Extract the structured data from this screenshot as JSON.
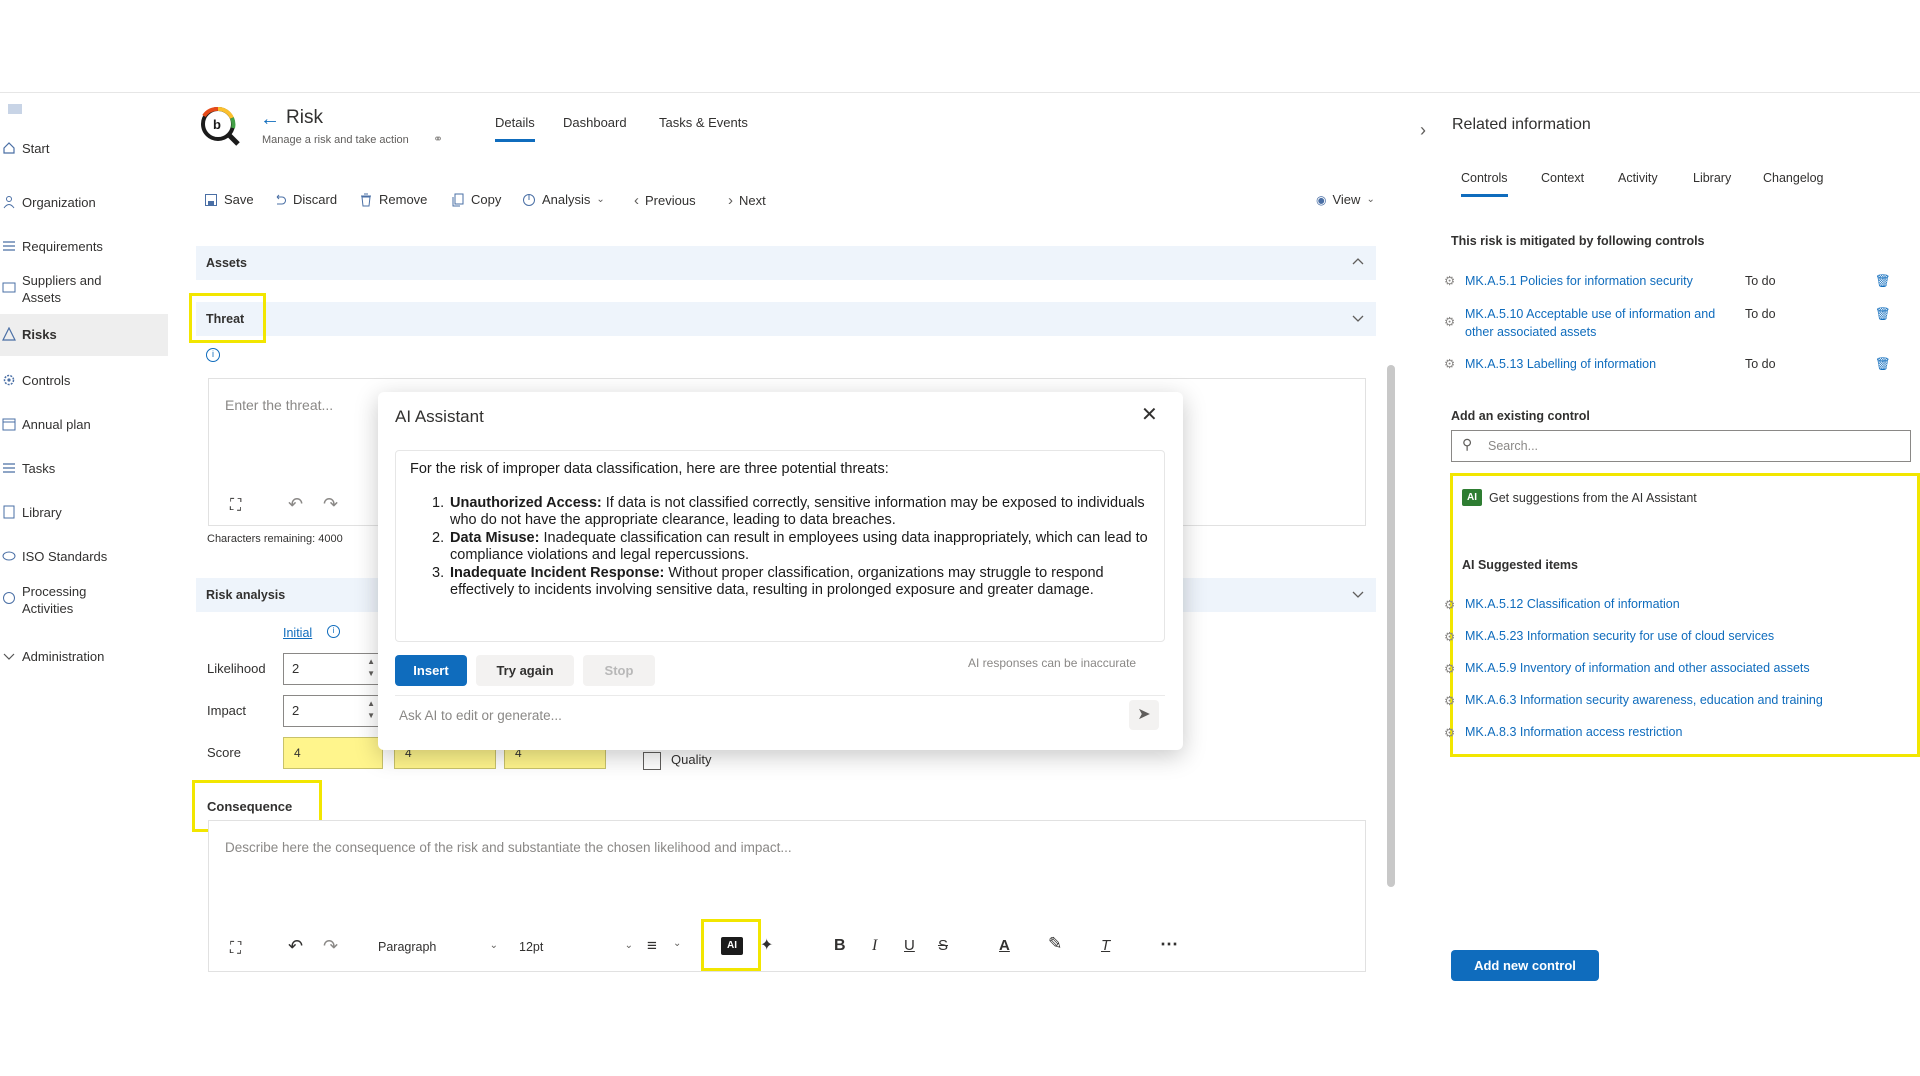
{
  "sidebar": {
    "items": [
      {
        "label": "Start",
        "icon": "home-icon"
      },
      {
        "label": "Organization",
        "icon": "org-icon"
      },
      {
        "label": "Requirements",
        "icon": "list-icon"
      },
      {
        "label": "Suppliers and Assets",
        "icon": "suppliers-icon"
      },
      {
        "label": "Risks",
        "icon": "warning-icon"
      },
      {
        "label": "Controls",
        "icon": "gear-icon"
      },
      {
        "label": "Annual plan",
        "icon": "calendar-icon"
      },
      {
        "label": "Tasks",
        "icon": "tasks-icon"
      },
      {
        "label": "Library",
        "icon": "library-icon"
      },
      {
        "label": "ISO Standards",
        "icon": "iso-icon"
      },
      {
        "label": "Processing Activities",
        "icon": "processing-icon"
      },
      {
        "label": "Administration",
        "icon": "chevron-icon"
      }
    ]
  },
  "header": {
    "title": "Risk",
    "subtitle": "Manage a risk and take action",
    "tabs": [
      "Details",
      "Dashboard",
      "Tasks & Events"
    ],
    "active_tab": "Details"
  },
  "toolbar": {
    "save": "Save",
    "discard": "Discard",
    "remove": "Remove",
    "copy": "Copy",
    "analysis": "Analysis",
    "previous": "Previous",
    "next": "Next",
    "view": "View"
  },
  "sections": {
    "assets": "Assets",
    "threat": "Threat",
    "threat_placeholder": "Enter the threat...",
    "chars_remaining": "Characters remaining: 4000",
    "risk_analysis": "Risk analysis",
    "initial": "Initial",
    "likelihood": "Likelihood",
    "likelihood_value": "2",
    "impact": "Impact",
    "impact_value": "2",
    "score": "Score",
    "scores": [
      "4",
      "4",
      "4"
    ],
    "quality": "Quality",
    "consequence": "Consequence",
    "consequence_placeholder": "Describe here the consequence of the risk and substantiate the chosen likelihood and impact...",
    "format_block": "Paragraph",
    "font_size": "12pt",
    "ai_button": "AI"
  },
  "ai_modal": {
    "title": "AI Assistant",
    "intro": "For the risk of improper data classification, here are three potential threats:",
    "items": [
      {
        "n": "1.",
        "title": "Unauthorized Access:",
        "text": " If data is not classified correctly, sensitive information may be exposed to individuals who do not have the appropriate clearance, leading to data breaches."
      },
      {
        "n": "2.",
        "title": "Data Misuse:",
        "text": " Inadequate classification can result in employees using data inappropriately, which can lead to compliance violations and legal repercussions."
      },
      {
        "n": "3.",
        "title": "Inadequate Incident Response:",
        "text": " Without proper classification, organizations may struggle to respond effectively to incidents involving sensitive data, resulting in prolonged exposure and greater damage."
      }
    ],
    "insert": "Insert",
    "try_again": "Try again",
    "stop": "Stop",
    "disclaimer": "AI responses can be inaccurate",
    "ask_placeholder": "Ask AI to edit or generate..."
  },
  "related": {
    "title": "Related information",
    "tabs": [
      "Controls",
      "Context",
      "Activity",
      "Library",
      "Changelog"
    ],
    "active_tab": "Controls",
    "mitigated_label": "This risk is mitigated by following controls",
    "controls": [
      {
        "name": "MK.A.5.1 Policies for information security",
        "status": "To do"
      },
      {
        "name": "MK.A.5.10 Acceptable use of information and other associated assets",
        "status": "To do"
      },
      {
        "name": "MK.A.5.13 Labelling of information",
        "status": "To do"
      }
    ],
    "add_existing": "Add an existing control",
    "search_placeholder": "Search...",
    "ai_badge": "AI",
    "ai_suggest_link": "Get suggestions from the AI Assistant",
    "ai_suggested_header": "AI Suggested items",
    "suggested": [
      "MK.A.5.12 Classification of information",
      "MK.A.5.23 Information security for use of cloud services",
      "MK.A.5.9 Inventory of information and other associated assets",
      "MK.A.6.3 Information security awareness, education and training",
      "MK.A.8.3 Information access restriction"
    ],
    "add_new": "Add new control"
  },
  "colors": {
    "accent": "#0f6cbd",
    "highlight": "#f2e600",
    "score_fill": "#fff58c",
    "section_bar": "#eef4fb"
  }
}
